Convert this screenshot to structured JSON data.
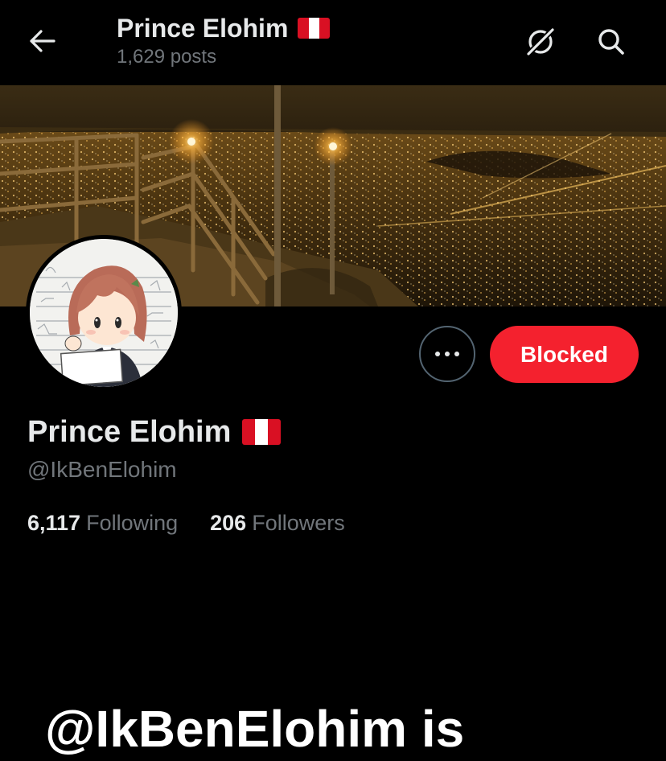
{
  "header": {
    "title": "Prince Elohim",
    "posts_count": "1,629 posts",
    "back_icon": "arrow-left-icon",
    "grok_icon": "grok-icon",
    "search_icon": "search-icon"
  },
  "flag": {
    "country": "Peru",
    "colors": [
      "#d91023",
      "#ffffff",
      "#d91023"
    ]
  },
  "profile": {
    "display_name": "Prince Elohim",
    "handle": "@IkBenElohim",
    "following_count": "6,117",
    "following_label": "Following",
    "followers_count": "206",
    "followers_label": "Followers"
  },
  "actions": {
    "more_icon": "more-horizontal-icon",
    "blocked_label": "Blocked"
  },
  "caption": {
    "text": "@IkBenElohim is"
  },
  "colors": {
    "background": "#000000",
    "primary_text": "#e7e9ea",
    "secondary_text": "#71767b",
    "blocked_button": "#f4212e",
    "border": "#536471"
  }
}
